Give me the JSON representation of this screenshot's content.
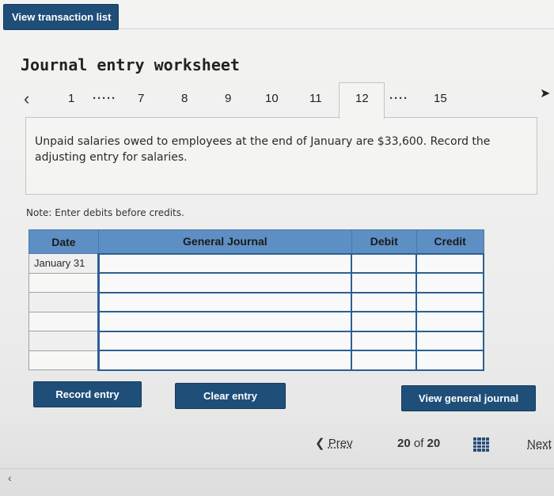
{
  "header": {
    "view_transactions_label": "View transaction list"
  },
  "worksheet": {
    "title": "Journal entry worksheet"
  },
  "pager": {
    "prev_icon": "chevron-left-icon",
    "items": [
      "1",
      "7",
      "8",
      "9",
      "10",
      "11",
      "12",
      "15"
    ],
    "dots": "·····",
    "dots2": "····",
    "active": "12"
  },
  "question": {
    "text": "Unpaid salaries owed to employees at the end of January are $33,600. Record the adjusting entry for salaries."
  },
  "note": "Note: Enter debits before credits.",
  "table": {
    "headers": {
      "date": "Date",
      "journal": "General Journal",
      "debit": "Debit",
      "credit": "Credit"
    },
    "rows": [
      {
        "date": "January 31",
        "account": "",
        "debit": "",
        "credit": ""
      },
      {
        "date": "",
        "account": "",
        "debit": "",
        "credit": ""
      },
      {
        "date": "",
        "account": "",
        "debit": "",
        "credit": ""
      },
      {
        "date": "",
        "account": "",
        "debit": "",
        "credit": ""
      },
      {
        "date": "",
        "account": "",
        "debit": "",
        "credit": ""
      },
      {
        "date": "",
        "account": "",
        "debit": "",
        "credit": ""
      }
    ]
  },
  "buttons": {
    "record": "Record entry",
    "clear": "Clear entry",
    "view_journal": "View general journal"
  },
  "nav": {
    "prev_label": "Prev",
    "current": "20",
    "of": "of",
    "total": "20",
    "next_label": "Next"
  },
  "colors": {
    "primary": "#1f4e79",
    "table_header": "#5d8fc4",
    "input_border": "#2c5f93"
  }
}
